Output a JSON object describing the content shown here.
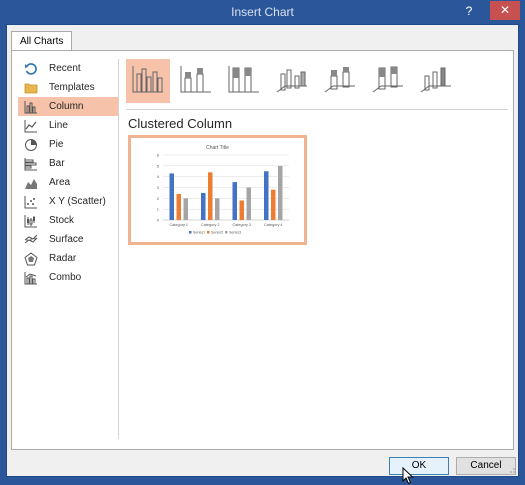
{
  "window": {
    "title": "Insert Chart",
    "help_label": "?",
    "close_label": "✕"
  },
  "tabs": [
    {
      "label": "All Charts"
    }
  ],
  "sidebar": {
    "items": [
      {
        "label": "Recent",
        "icon": "recent-icon"
      },
      {
        "label": "Templates",
        "icon": "folder-icon"
      },
      {
        "label": "Column",
        "icon": "column-chart-icon",
        "selected": true
      },
      {
        "label": "Line",
        "icon": "line-chart-icon"
      },
      {
        "label": "Pie",
        "icon": "pie-chart-icon"
      },
      {
        "label": "Bar",
        "icon": "bar-chart-icon"
      },
      {
        "label": "Area",
        "icon": "area-chart-icon"
      },
      {
        "label": "X Y (Scatter)",
        "icon": "scatter-chart-icon"
      },
      {
        "label": "Stock",
        "icon": "stock-chart-icon"
      },
      {
        "label": "Surface",
        "icon": "surface-chart-icon"
      },
      {
        "label": "Radar",
        "icon": "radar-chart-icon"
      },
      {
        "label": "Combo",
        "icon": "combo-chart-icon"
      }
    ]
  },
  "main": {
    "chart_types": [
      {
        "icon": "clustered-column-icon",
        "selected": true
      },
      {
        "icon": "stacked-column-icon"
      },
      {
        "icon": "100-stacked-column-icon"
      },
      {
        "icon": "3d-clustered-column-icon"
      },
      {
        "icon": "3d-stacked-column-icon"
      },
      {
        "icon": "3d-100-stacked-column-icon"
      },
      {
        "icon": "3d-column-icon"
      }
    ],
    "subtitle": "Clustered Column"
  },
  "chart_data": {
    "type": "bar",
    "title": "Chart Title",
    "categories": [
      "Category 1",
      "Category 2",
      "Category 3",
      "Category 4"
    ],
    "series": [
      {
        "name": "Series1",
        "values": [
          4.3,
          2.5,
          3.5,
          4.5
        ],
        "color": "#4472c4"
      },
      {
        "name": "Series2",
        "values": [
          2.4,
          4.4,
          1.8,
          2.8
        ],
        "color": "#ed7d31"
      },
      {
        "name": "Series3",
        "values": [
          2,
          2,
          3,
          5
        ],
        "color": "#a5a5a5"
      }
    ],
    "yticks": [
      "0",
      "1",
      "2",
      "3",
      "4",
      "5",
      "6"
    ],
    "ylim": [
      0,
      6
    ],
    "grid": true,
    "legend": "bottom"
  },
  "footer": {
    "ok_label": "OK",
    "cancel_label": "Cancel"
  },
  "colors": {
    "accent": "#2b579a",
    "selection": "#f6c2a9",
    "close": "#c75050"
  }
}
